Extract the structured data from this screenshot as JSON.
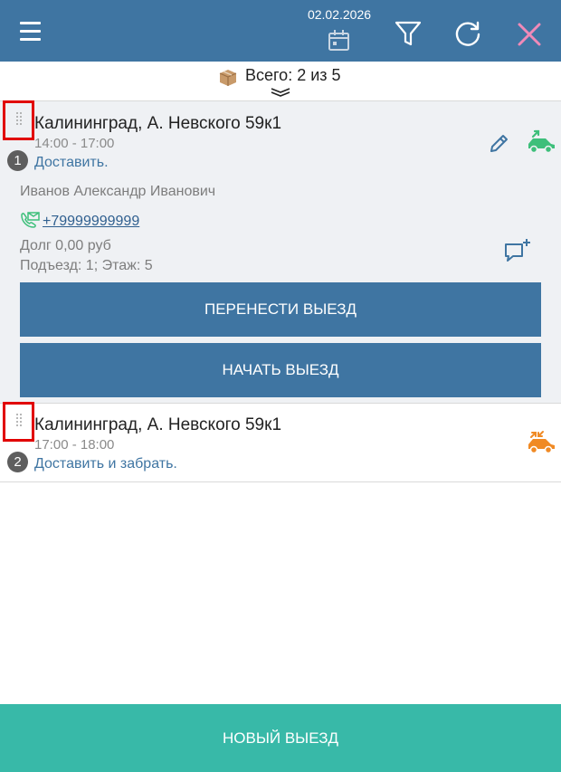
{
  "header": {
    "date": "02.02.2026",
    "icons": [
      "menu-icon",
      "calendar-icon",
      "filter-icon",
      "refresh-icon",
      "close-icon"
    ],
    "colors": {
      "bar": "#3f75a2",
      "close": "#f08ab8"
    }
  },
  "summary": {
    "text": "Всего: 2 из 5",
    "icon": "box-icon"
  },
  "orders": [
    {
      "number": "1",
      "address": "Калининград, А. Невского 59к1",
      "time": "14:00 - 17:00",
      "action": "Доставить.",
      "customer": "Иванов Александр Иванович",
      "phone": "+79999999999",
      "debt": "Долг 0,00 руб",
      "entrance": "Подъезд: 1; Этаж: 5",
      "buttons": {
        "move": "ПЕРЕНЕСТИ ВЫЕЗД",
        "start": "НАЧАТЬ ВЫЕЗД"
      },
      "car_color": "#3dbf7a"
    },
    {
      "number": "2",
      "address": "Калининград, А. Невского 59к1",
      "time": "17:00 - 18:00",
      "action": "Доставить и забрать.",
      "car_color": "#f08a24"
    }
  ],
  "footer": {
    "new_button": "НОВЫЙ ВЫЕЗД",
    "color": "#38b9a8"
  }
}
